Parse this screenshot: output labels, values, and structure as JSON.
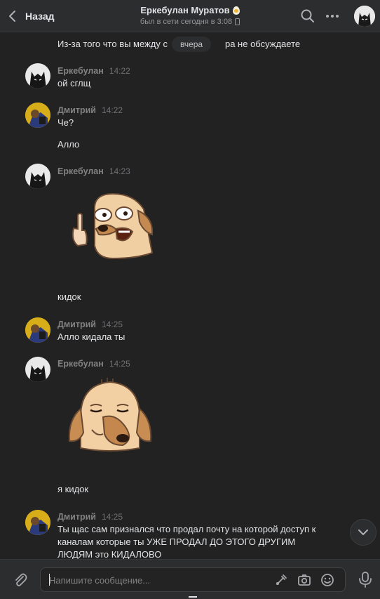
{
  "header": {
    "back_label": "Назад",
    "peer_name": "Еркебулан Муратов",
    "peer_status": "был в сети сегодня в 3:08"
  },
  "feed": {
    "date_divider": "вчера",
    "top_fragment": "Из-за того что вы между с",
    "top_fragment_tail": "ра не обсуждаете",
    "messages": [
      {
        "author": "Еркебулан",
        "time": "14:22",
        "text": "ой сглщ"
      },
      {
        "author": "Дмитрий",
        "time": "14:22",
        "text": "Че?",
        "followup": "Алло"
      },
      {
        "author": "Еркебулан",
        "time": "14:23",
        "sticker": "dog-middle-finger-sticker",
        "followup": "кидок"
      },
      {
        "author": "Дмитрий",
        "time": "14:25",
        "text": "Алло кидала ты"
      },
      {
        "author": "Еркебулан",
        "time": "14:25",
        "sticker": "dog-smug-sticker",
        "followup": "я кидок"
      },
      {
        "author": "Дмитрий",
        "time": "14:25",
        "lines": [
          "Ты щас сам признался что продал почту на которой доступ к",
          "каналам которые ты УЖЕ ПРОДАЛ ДО ЭТОГО ДРУГИМ",
          "ЛЮДЯМ это КИДАЛОВО"
        ]
      }
    ]
  },
  "composer": {
    "placeholder": "Напишите сообщение..."
  },
  "colors": {
    "background": "#222222",
    "panel": "#2c2d2e",
    "text": "#e1e3e6",
    "muted": "#828282"
  }
}
